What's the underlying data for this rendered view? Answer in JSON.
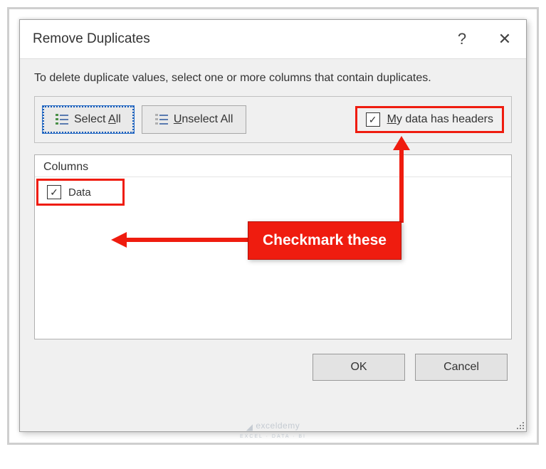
{
  "dialog": {
    "title": "Remove Duplicates",
    "help_symbol": "?",
    "close_symbol": "✕",
    "description": "To delete duplicate values, select one or more columns that contain duplicates."
  },
  "toolbar": {
    "select_all_pre": "Select ",
    "select_all_key": "A",
    "select_all_post": "ll",
    "unselect_all_pre": "",
    "unselect_all_key": "U",
    "unselect_all_post": "nselect All",
    "headers_pre": "",
    "headers_key": "M",
    "headers_post": "y data has headers",
    "headers_checked": "✓"
  },
  "columns": {
    "header": "Columns",
    "items": [
      {
        "label": "Data",
        "checked": "✓"
      }
    ]
  },
  "buttons": {
    "ok": "OK",
    "cancel": "Cancel"
  },
  "annotation": {
    "callout": "Checkmark these"
  },
  "watermark": {
    "main": "exceldemy",
    "sub": "EXCEL · DATA · BI"
  }
}
